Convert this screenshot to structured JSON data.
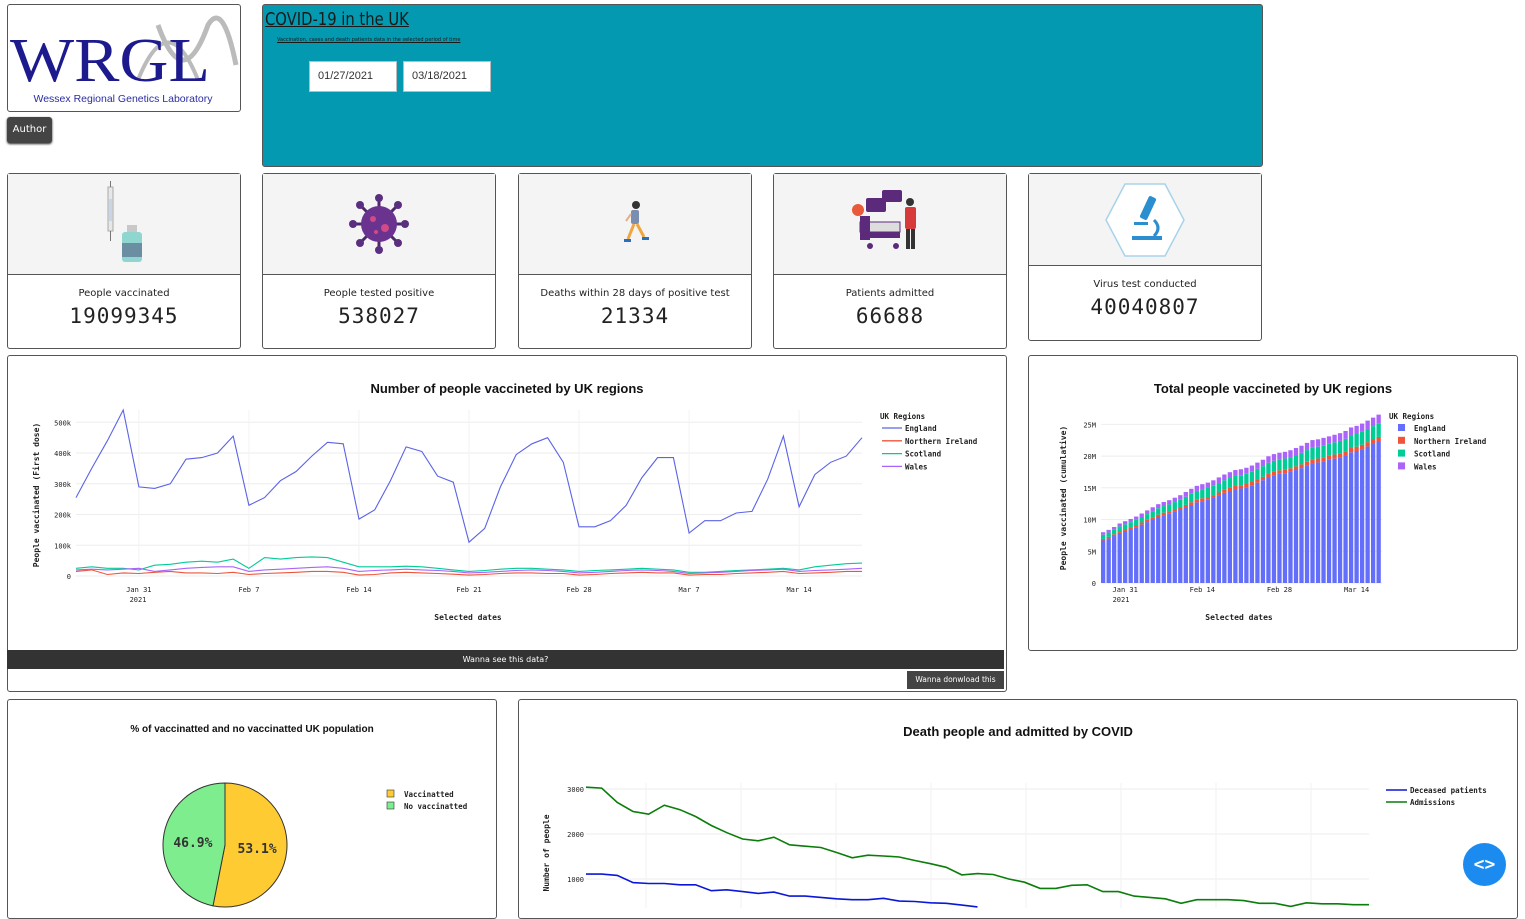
{
  "logo": {
    "letters": "WRGL",
    "caption": "Wessex Regional Genetics Laboratory"
  },
  "author_button": "Author",
  "header": {
    "title": "COVID-19 in the UK",
    "subtitle": "Vaccination, cases and death patients data in the selected period of time",
    "start_date": "01/27/2021",
    "end_date": "03/18/2021",
    "background": "#0399b0"
  },
  "stats": [
    {
      "label": "People vaccinated",
      "value": "19099345",
      "icon": "vaccine-syringe-icon"
    },
    {
      "label": "People tested positive",
      "value": "538027",
      "icon": "virus-icon"
    },
    {
      "label": "Deaths within 28 days of positive test",
      "value": "21334",
      "icon": "falling-person-icon"
    },
    {
      "label": "Patients admitted",
      "value": "66688",
      "icon": "hospital-bed-icon"
    },
    {
      "label": "Virus test conducted",
      "value": "40040807",
      "icon": "microscope-icon"
    }
  ],
  "line_chart": {
    "title": "Number of people vaccineted by UK regions",
    "ylabel": "People vaccinated (First dose)",
    "xlabel": "Selected dates",
    "legend_title": "UK Regions",
    "y_ticks": [
      "500k",
      "400k",
      "300k",
      "200k",
      "100k",
      "0"
    ],
    "x_ticks": [
      "Jan 31",
      "Feb 7",
      "Feb 14",
      "Feb 21",
      "Feb 28",
      "Mar 7",
      "Mar 14"
    ],
    "year_label": "2021"
  },
  "bar_chart": {
    "title": "Total people vaccineted by UK regions",
    "ylabel": "People vaccinated (cumulative)",
    "xlabel": "Selected dates",
    "legend_title": "UK Regions",
    "y_ticks": [
      "25M",
      "20M",
      "15M",
      "10M",
      "5M",
      "0"
    ],
    "x_ticks": [
      "Jan 31",
      "Feb 14",
      "Feb 28",
      "Mar 14"
    ],
    "year_label": "2021"
  },
  "pie_chart": {
    "title": "% of vaccinatted and no vaccinatted UK population"
  },
  "death_chart": {
    "title": "Death people and admitted by COVID",
    "ylabel": "Number of people",
    "y_ticks": [
      "3000",
      "2000",
      "1000"
    ]
  },
  "see_data_label": "Wanna see this data?",
  "download_label": "Wanna donwload this data",
  "chart_data": [
    {
      "type": "line",
      "title": "Number of people vaccineted by UK regions",
      "xlabel": "Selected dates",
      "ylabel": "People vaccinated (First dose)",
      "x": [
        "2021-01-27",
        "2021-01-28",
        "2021-01-29",
        "2021-01-30",
        "2021-01-31",
        "2021-02-01",
        "2021-02-02",
        "2021-02-03",
        "2021-02-04",
        "2021-02-05",
        "2021-02-06",
        "2021-02-07",
        "2021-02-08",
        "2021-02-09",
        "2021-02-10",
        "2021-02-11",
        "2021-02-12",
        "2021-02-13",
        "2021-02-14",
        "2021-02-15",
        "2021-02-16",
        "2021-02-17",
        "2021-02-18",
        "2021-02-19",
        "2021-02-20",
        "2021-02-21",
        "2021-02-22",
        "2021-02-23",
        "2021-02-24",
        "2021-02-25",
        "2021-02-26",
        "2021-02-27",
        "2021-02-28",
        "2021-03-01",
        "2021-03-02",
        "2021-03-03",
        "2021-03-04",
        "2021-03-05",
        "2021-03-06",
        "2021-03-07",
        "2021-03-08",
        "2021-03-09",
        "2021-03-10",
        "2021-03-11",
        "2021-03-12",
        "2021-03-13",
        "2021-03-14",
        "2021-03-15",
        "2021-03-16",
        "2021-03-17",
        "2021-03-18"
      ],
      "ylim": [
        0,
        540000
      ],
      "legend_title": "UK Regions",
      "legend_position": "top-right",
      "series": [
        {
          "name": "England",
          "color": "#5b63e6",
          "values": [
            255000,
            350000,
            440000,
            540000,
            290000,
            285000,
            300000,
            380000,
            385000,
            400000,
            455000,
            230000,
            255000,
            310000,
            340000,
            390000,
            435000,
            430000,
            185000,
            215000,
            310000,
            420000,
            405000,
            325000,
            305000,
            110000,
            155000,
            290000,
            395000,
            430000,
            450000,
            370000,
            160000,
            160000,
            180000,
            230000,
            320000,
            385000,
            385000,
            140000,
            180000,
            180000,
            205000,
            210000,
            315000,
            455000,
            225000,
            330000,
            370000,
            390000,
            450000
          ]
        },
        {
          "name": "Northern Ireland",
          "color": "#ef553b",
          "values": [
            15000,
            20000,
            5000,
            10000,
            8000,
            12000,
            15000,
            10000,
            10000,
            8000,
            12000,
            5000,
            8000,
            10000,
            12000,
            15000,
            15000,
            12000,
            3000,
            5000,
            10000,
            12000,
            10000,
            8000,
            6000,
            3000,
            5000,
            8000,
            10000,
            10000,
            8000,
            8000,
            3000,
            5000,
            8000,
            10000,
            12000,
            10000,
            10000,
            3000,
            5000,
            5000,
            8000,
            10000,
            12000,
            15000,
            8000,
            10000,
            12000,
            15000,
            15000
          ]
        },
        {
          "name": "Scotland",
          "color": "#00cc96",
          "values": [
            25000,
            30000,
            25000,
            25000,
            20000,
            35000,
            38000,
            45000,
            48000,
            45000,
            55000,
            25000,
            60000,
            55000,
            60000,
            62000,
            60000,
            45000,
            30000,
            30000,
            30000,
            32000,
            30000,
            25000,
            20000,
            15000,
            18000,
            22000,
            25000,
            25000,
            22000,
            20000,
            15000,
            18000,
            20000,
            22000,
            25000,
            22000,
            20000,
            12000,
            12000,
            15000,
            18000,
            20000,
            22000,
            25000,
            20000,
            30000,
            35000,
            40000,
            42000
          ]
        },
        {
          "name": "Wales",
          "color": "#ab63fa",
          "values": [
            20000,
            22000,
            20000,
            22000,
            25000,
            15000,
            20000,
            25000,
            28000,
            30000,
            30000,
            15000,
            20000,
            22000,
            25000,
            28000,
            30000,
            25000,
            15000,
            18000,
            20000,
            22000,
            20000,
            18000,
            15000,
            10000,
            12000,
            15000,
            18000,
            20000,
            18000,
            15000,
            10000,
            12000,
            15000,
            18000,
            20000,
            18000,
            15000,
            8000,
            10000,
            12000,
            15000,
            18000,
            20000,
            22000,
            15000,
            18000,
            20000,
            22000,
            25000
          ]
        }
      ]
    },
    {
      "type": "bar",
      "stacked": true,
      "title": "Total people vaccineted by UK regions",
      "xlabel": "Selected dates",
      "ylabel": "People vaccinated (cumulative)",
      "x_start": "2021-01-27",
      "x_end": "2021-03-18",
      "ylim": [
        0,
        26000000
      ],
      "legend_title": "UK Regions",
      "legend_position": "top-right",
      "series": [
        {
          "name": "England",
          "color": "#636efa",
          "values": [
            6.7,
            7.0,
            7.4,
            7.9,
            8.2,
            8.5,
            8.8,
            9.2,
            9.6,
            10.0,
            10.4,
            10.7,
            10.9,
            11.2,
            11.5,
            11.9,
            12.3,
            12.7,
            12.9,
            13.1,
            13.4,
            13.8,
            14.2,
            14.5,
            14.8,
            14.9,
            15.1,
            15.4,
            15.8,
            16.2,
            16.7,
            17.0,
            17.2,
            17.3,
            17.5,
            17.8,
            18.1,
            18.5,
            18.9,
            19.0,
            19.2,
            19.4,
            19.6,
            19.8,
            20.1,
            20.6,
            20.8,
            21.1,
            21.5,
            21.9,
            22.3
          ]
        },
        {
          "name": "Northern Ireland",
          "color": "#ef553b",
          "values": [
            0.25,
            0.27,
            0.28,
            0.29,
            0.3,
            0.31,
            0.33,
            0.34,
            0.35,
            0.36,
            0.37,
            0.38,
            0.38,
            0.39,
            0.4,
            0.41,
            0.42,
            0.43,
            0.44,
            0.44,
            0.45,
            0.46,
            0.47,
            0.48,
            0.49,
            0.49,
            0.5,
            0.51,
            0.52,
            0.53,
            0.54,
            0.55,
            0.55,
            0.56,
            0.57,
            0.58,
            0.59,
            0.6,
            0.61,
            0.61,
            0.62,
            0.63,
            0.64,
            0.65,
            0.66,
            0.67,
            0.68,
            0.69,
            0.7,
            0.71,
            0.72
          ]
        },
        {
          "name": "Scotland",
          "color": "#00cc96",
          "values": [
            0.65,
            0.68,
            0.7,
            0.73,
            0.75,
            0.78,
            0.82,
            0.86,
            0.91,
            0.96,
            1.01,
            1.04,
            1.1,
            1.16,
            1.22,
            1.28,
            1.34,
            1.38,
            1.41,
            1.44,
            1.47,
            1.5,
            1.53,
            1.56,
            1.58,
            1.59,
            1.61,
            1.63,
            1.66,
            1.68,
            1.7,
            1.72,
            1.73,
            1.75,
            1.77,
            1.79,
            1.82,
            1.84,
            1.86,
            1.87,
            1.88,
            1.9,
            1.92,
            1.94,
            1.96,
            1.98,
            2.0,
            2.03,
            2.07,
            2.11,
            2.15
          ]
        },
        {
          "name": "Wales",
          "color": "#ab63fa",
          "values": [
            0.4,
            0.42,
            0.44,
            0.46,
            0.49,
            0.5,
            0.52,
            0.55,
            0.58,
            0.61,
            0.64,
            0.65,
            0.67,
            0.69,
            0.72,
            0.75,
            0.78,
            0.8,
            0.82,
            0.84,
            0.86,
            0.88,
            0.9,
            0.92,
            0.93,
            0.94,
            0.95,
            0.97,
            0.99,
            1.01,
            1.03,
            1.04,
            1.05,
            1.06,
            1.08,
            1.1,
            1.12,
            1.14,
            1.15,
            1.16,
            1.17,
            1.18,
            1.2,
            1.22,
            1.24,
            1.26,
            1.28,
            1.3,
            1.32,
            1.34,
            1.36
          ]
        }
      ],
      "unit": "millions"
    },
    {
      "type": "pie",
      "title": "% of vaccinatted and no vaccinatted UK population",
      "labels": [
        "Vaccinatted",
        "No vaccinatted"
      ],
      "values": [
        53.1,
        46.9
      ],
      "value_labels": [
        "53.1%",
        "46.9%"
      ],
      "colors": [
        "#fecb32",
        "#7ded8e"
      ],
      "legend_position": "top-right"
    },
    {
      "type": "line",
      "title": "Death people and admitted by COVID",
      "ylabel": "Number of people",
      "ylim": [
        700,
        3100
      ],
      "legend_position": "top-right",
      "series": [
        {
          "name": "Deceased patients",
          "color": "#0b17d6",
          "values": [
            1110,
            1110,
            1080,
            920,
            900,
            900,
            870,
            870,
            740,
            760,
            720,
            680,
            710,
            620,
            620,
            590,
            560,
            540,
            540,
            570,
            510,
            500,
            470,
            460,
            420,
            380
          ]
        },
        {
          "name": "Admissions",
          "color": "#0a7d0a",
          "values": [
            3040,
            3020,
            2700,
            2500,
            2440,
            2640,
            2540,
            2390,
            2190,
            2030,
            1890,
            1850,
            1930,
            1760,
            1730,
            1700,
            1590,
            1470,
            1530,
            1510,
            1490,
            1410,
            1340,
            1260,
            1090,
            1120,
            1100,
            1000,
            930,
            790,
            790,
            860,
            870,
            720,
            720,
            620,
            590,
            560,
            460,
            540,
            540,
            540,
            520,
            460,
            460,
            390,
            470,
            450,
            450,
            430,
            430
          ]
        }
      ]
    }
  ]
}
